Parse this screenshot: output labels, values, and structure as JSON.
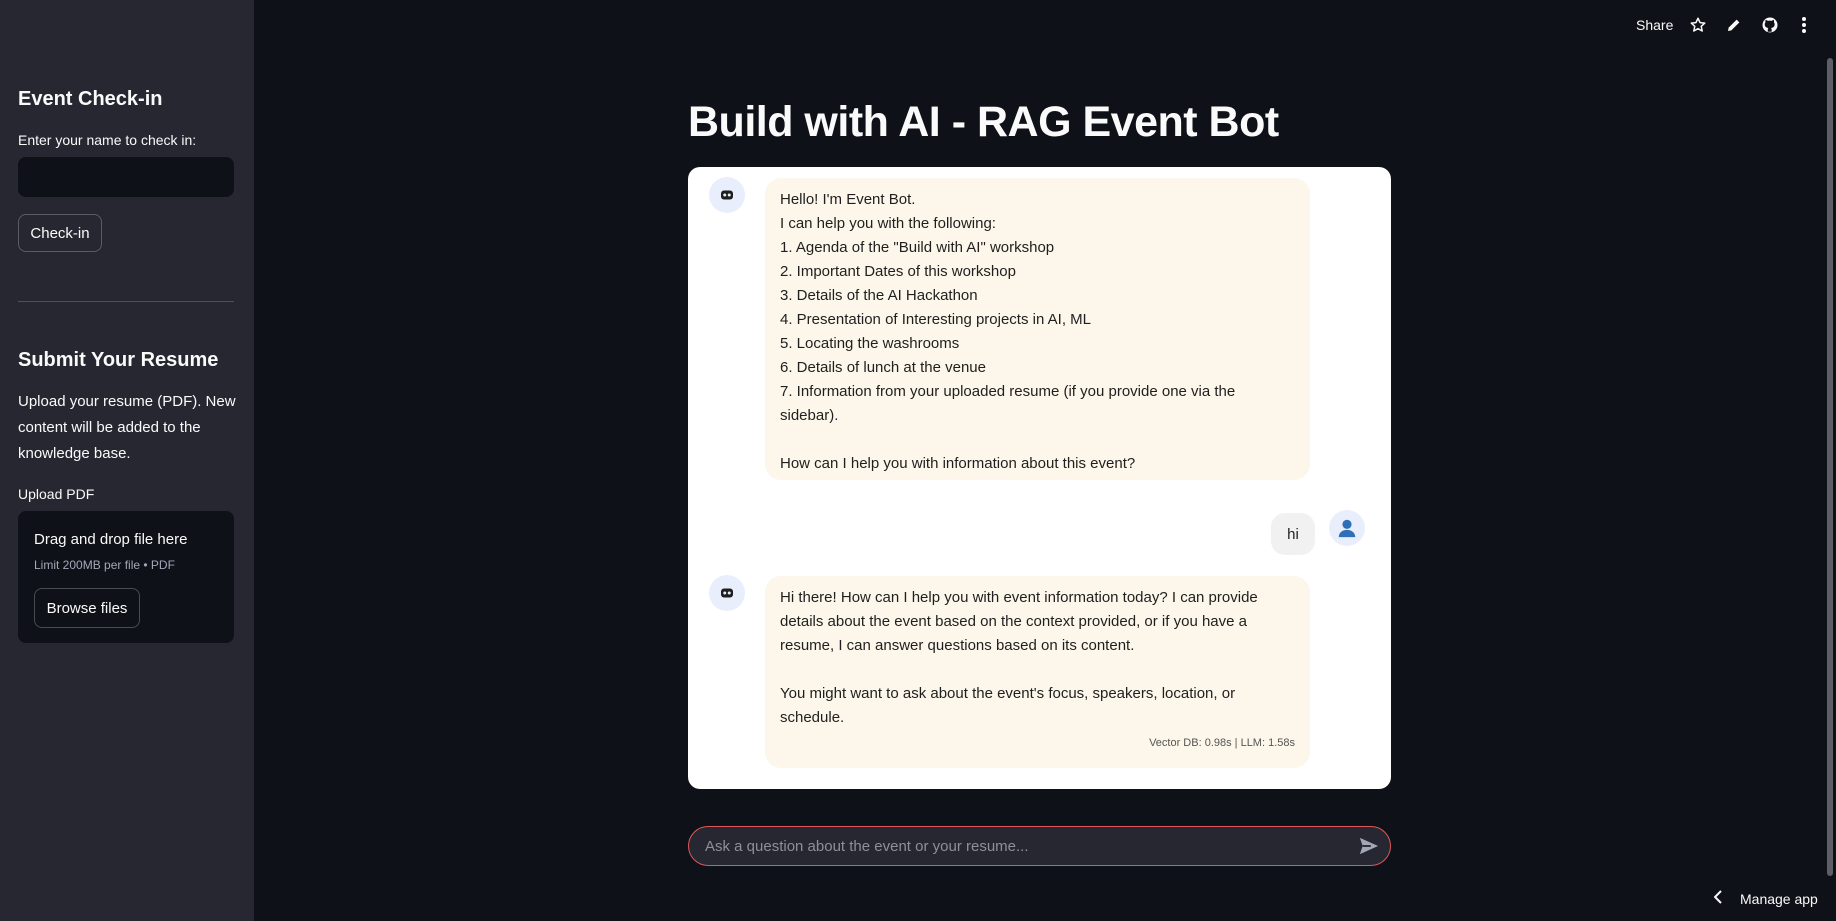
{
  "sidebar": {
    "checkin_heading": "Event Check-in",
    "checkin_label": "Enter your name to check in:",
    "checkin_value": "",
    "checkin_button": "Check-in",
    "resume_heading": "Submit Your Resume",
    "resume_description": "Upload your resume (PDF). New content will be added to the knowledge base.",
    "upload_label": "Upload PDF",
    "dropzone_title": "Drag and drop file here",
    "dropzone_limit": "Limit 200MB per file • PDF",
    "browse_button": "Browse files"
  },
  "header": {
    "share": "Share",
    "icons": [
      "star-icon",
      "pencil-icon",
      "github-icon",
      "kebab-menu-icon"
    ]
  },
  "main": {
    "title": "Build with AI - RAG Event Bot",
    "messages": [
      {
        "role": "assistant",
        "text": "Hello! I'm Event Bot.\nI can help you with the following:\n1. Agenda of the \"Build with AI\" workshop\n2. Important Dates of this workshop\n3. Details of the AI Hackathon\n4. Presentation of Interesting projects in AI, ML\n5. Locating the washrooms\n6. Details of lunch at the venue\n7. Information from your uploaded resume (if you provide one via the sidebar).\n\nHow can I help you with information about this event?"
      },
      {
        "role": "user",
        "text": "hi"
      },
      {
        "role": "assistant",
        "text": "Hi there! How can I help you with event information today? I can provide details about the event based on the context provided, or if you have a resume, I can answer questions based on its content.\n\nYou might want to ask about the event's focus, speakers, location, or schedule.",
        "meta": "Vector DB: 0.98s | LLM: 1.58s"
      }
    ],
    "chat_input_placeholder": "Ask a question about the event or your resume..."
  },
  "footer": {
    "manage_app": "Manage app"
  },
  "colors": {
    "background": "#0e1117",
    "sidebar": "#262730",
    "bubble": "#fcf7ea",
    "input_border": "#e0575b"
  }
}
